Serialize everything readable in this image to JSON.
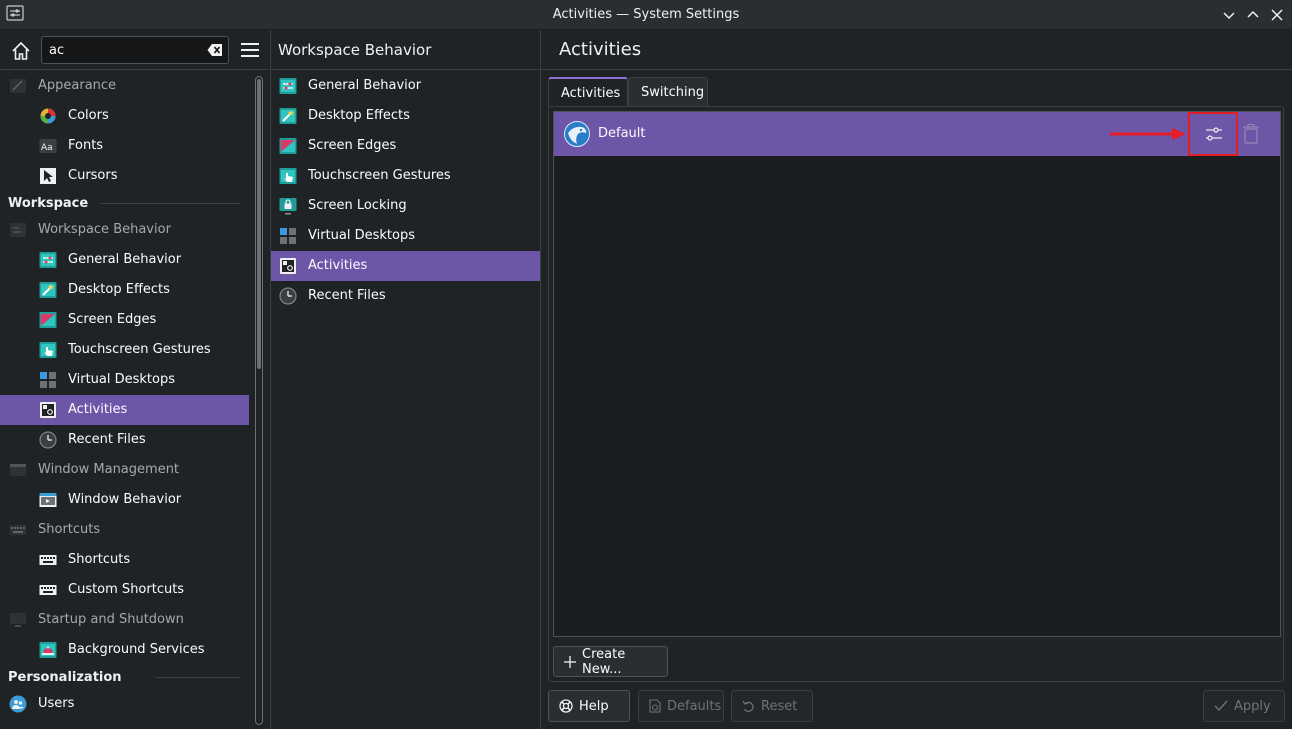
{
  "window": {
    "title": "Activities — System Settings"
  },
  "search": {
    "value": "ac"
  },
  "sidebar": {
    "items": [
      {
        "kind": "category",
        "label": "Appearance",
        "icon": "appearance-icon"
      },
      {
        "kind": "sub",
        "label": "Colors",
        "icon": "colors-icon"
      },
      {
        "kind": "sub",
        "label": "Fonts",
        "icon": "fonts-icon"
      },
      {
        "kind": "sub",
        "label": "Cursors",
        "icon": "cursors-icon"
      },
      {
        "kind": "section",
        "label": "Workspace"
      },
      {
        "kind": "category",
        "label": "Workspace Behavior",
        "icon": "workspace-behavior-icon"
      },
      {
        "kind": "sub",
        "label": "General Behavior",
        "icon": "general-behavior-icon"
      },
      {
        "kind": "sub",
        "label": "Desktop Effects",
        "icon": "desktop-effects-icon"
      },
      {
        "kind": "sub",
        "label": "Screen Edges",
        "icon": "screen-edges-icon"
      },
      {
        "kind": "sub",
        "label": "Touchscreen Gestures",
        "icon": "touchscreen-gestures-icon"
      },
      {
        "kind": "sub",
        "label": "Virtual Desktops",
        "icon": "virtual-desktops-icon"
      },
      {
        "kind": "sub",
        "label": "Activities",
        "icon": "activities-icon",
        "selected": true
      },
      {
        "kind": "sub",
        "label": "Recent Files",
        "icon": "recent-files-icon"
      },
      {
        "kind": "category",
        "label": "Window Management",
        "icon": "window-management-icon"
      },
      {
        "kind": "sub",
        "label": "Window Behavior",
        "icon": "window-behavior-icon"
      },
      {
        "kind": "category",
        "label": "Shortcuts",
        "icon": "shortcuts-category-icon"
      },
      {
        "kind": "sub",
        "label": "Shortcuts",
        "icon": "keyboard-icon"
      },
      {
        "kind": "sub",
        "label": "Custom Shortcuts",
        "icon": "keyboard-icon"
      },
      {
        "kind": "category",
        "label": "Startup and Shutdown",
        "icon": "startup-shutdown-icon"
      },
      {
        "kind": "sub",
        "label": "Background Services",
        "icon": "background-services-icon"
      },
      {
        "kind": "section",
        "label": "Personalization"
      },
      {
        "kind": "sub-top",
        "label": "Users",
        "icon": "users-icon"
      }
    ]
  },
  "middle": {
    "title": "Workspace Behavior",
    "items": [
      {
        "label": "General Behavior",
        "icon": "general-behavior-icon"
      },
      {
        "label": "Desktop Effects",
        "icon": "desktop-effects-icon"
      },
      {
        "label": "Screen Edges",
        "icon": "screen-edges-icon"
      },
      {
        "label": "Touchscreen Gestures",
        "icon": "touchscreen-gestures-icon"
      },
      {
        "label": "Screen Locking",
        "icon": "screen-locking-icon"
      },
      {
        "label": "Virtual Desktops",
        "icon": "virtual-desktops-icon"
      },
      {
        "label": "Activities",
        "icon": "activities-icon",
        "selected": true
      },
      {
        "label": "Recent Files",
        "icon": "recent-files-icon"
      }
    ]
  },
  "content": {
    "title": "Activities",
    "tabs": [
      {
        "label": "Activities",
        "active": true
      },
      {
        "label": "Switching",
        "active": false
      }
    ],
    "activities": [
      {
        "label": "Default",
        "icon": "activity-default-icon"
      }
    ],
    "create_label": "Create New...",
    "footer": {
      "help": "Help",
      "defaults": "Defaults",
      "reset": "Reset",
      "apply": "Apply"
    }
  },
  "colors": {
    "accent": "#6d55a7",
    "highlight_frame": "#e51d24",
    "background": "#202326"
  }
}
